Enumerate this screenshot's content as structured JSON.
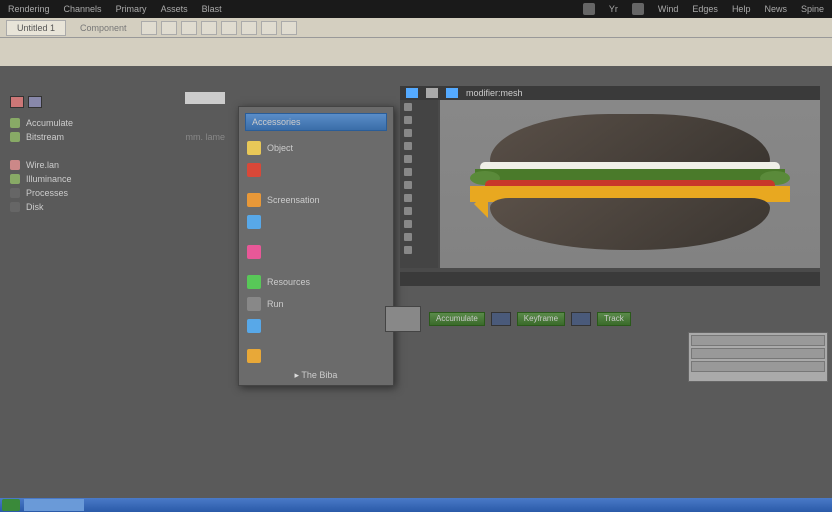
{
  "menubar": {
    "items": [
      "Rendering",
      "Channels",
      "Primary",
      "Assets",
      "Blast"
    ],
    "right": [
      "Yr",
      "Wind",
      "Edges",
      "Help",
      "News",
      "Spine"
    ]
  },
  "toolbar": {
    "tab": "Untitled 1",
    "breadcrumb": "Component"
  },
  "sidebar": {
    "items": [
      {
        "label": "Accumulate",
        "dim": false
      },
      {
        "label": "Bitstream",
        "dim": false,
        "right": "mm. lame"
      },
      {
        "label": "Wire.lan",
        "dim": false,
        "divider": true
      },
      {
        "label": "Illuminance",
        "dim": false
      },
      {
        "label": "Processes",
        "dim": true
      },
      {
        "label": "Disk",
        "dim": true
      }
    ]
  },
  "startmenu": {
    "selected": "Accessories",
    "items": [
      {
        "label": "Object",
        "color": "#e8c858"
      },
      {
        "label": "",
        "color": "#d84838"
      },
      {
        "label": "Screensation",
        "color": "#e89838"
      },
      {
        "label": "",
        "color": "#58a8e8"
      },
      {
        "label": "",
        "color": "#e85898"
      },
      {
        "label": "Resources",
        "color": "#58c858"
      },
      {
        "label": "Run",
        "color": "#888"
      },
      {
        "label": "",
        "color": "#58a8e8"
      },
      {
        "label": "",
        "color": "#e8a838"
      }
    ],
    "footer": "The Biba"
  },
  "viewport": {
    "title": "modifier:mesh"
  },
  "timeline": {
    "clips": [
      "Accumulate",
      "",
      "Keyframe",
      "",
      "Track"
    ]
  },
  "props": {
    "rows": [
      "",
      "",
      ""
    ]
  }
}
